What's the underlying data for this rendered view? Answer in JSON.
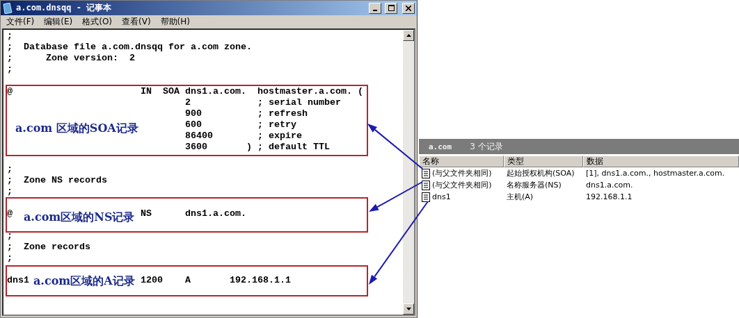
{
  "notepad": {
    "title": "a.com.dnsqq - 记事本",
    "menu": [
      "文件(F)",
      "编辑(E)",
      "格式(O)",
      "查看(V)",
      "帮助(H)"
    ],
    "blocks": [
      [
        ";",
        ";  Database file a.com.dnsqq for a.com zone.",
        ";      Zone version:  2",
        ";"
      ],
      [
        "@                       IN  SOA dns1.a.com.  hostmaster.a.com. (",
        "                                2            ; serial number",
        "                                900          ; refresh",
        "                                600          ; retry",
        "                                86400        ; expire",
        "                                3600       ) ; default TTL"
      ],
      [
        ";",
        ";  Zone NS records",
        ";"
      ],
      [
        "@                       NS      dns1.a.com."
      ],
      [
        ";",
        ";  Zone records",
        ";"
      ],
      [
        "dns1                    1200    A       192.168.1.1"
      ]
    ]
  },
  "annotations": [
    {
      "label": "a.com 区域的SOA记录"
    },
    {
      "label": "a.com区域的NS记录"
    },
    {
      "label": "a.com区域的A记录"
    }
  ],
  "dns_panel": {
    "zone": "a.com",
    "count": "3 个记录",
    "columns": [
      "名称",
      "类型",
      "数据"
    ],
    "rows": [
      {
        "name": "(与父文件夹相同)",
        "type": "起始授权机构(SOA)",
        "data": "[1], dns1.a.com., hostmaster.a.com."
      },
      {
        "name": "(与父文件夹相同)",
        "type": "名称服务器(NS)",
        "data": "dns1.a.com."
      },
      {
        "name": "dns1",
        "type": "主机(A)",
        "data": "192.168.1.1"
      }
    ]
  }
}
